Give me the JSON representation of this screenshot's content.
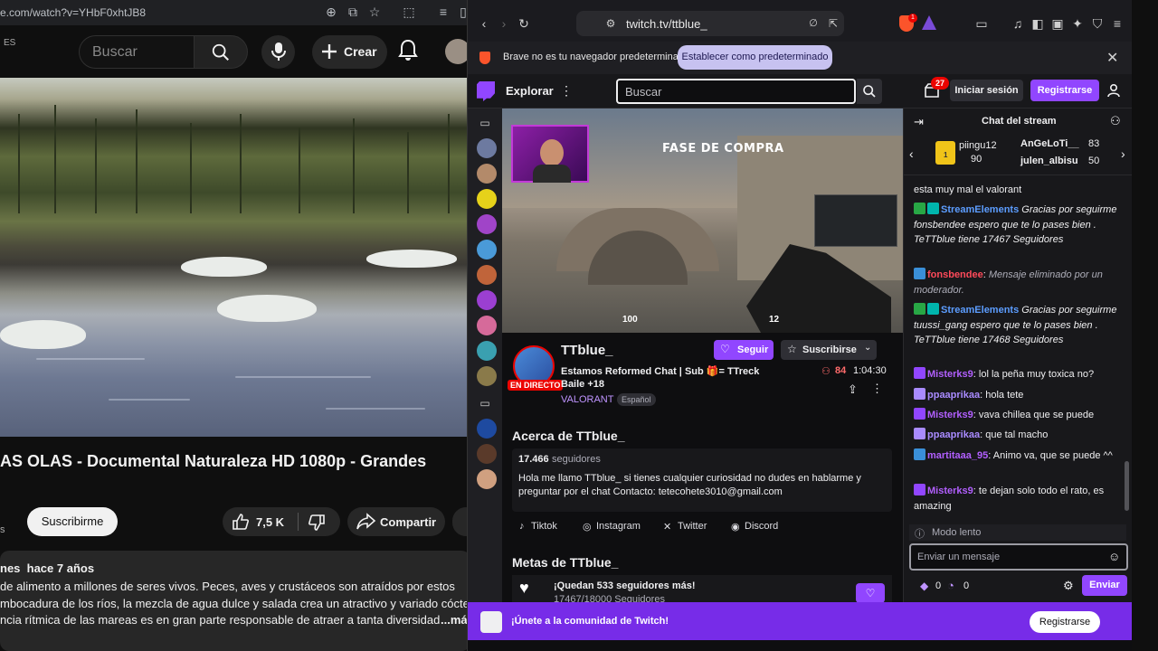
{
  "youtube": {
    "url": "e.com/watch?v=YHbF0xhtJB8",
    "country_code": "ES",
    "search_placeholder": "Buscar",
    "create_label": "Crear",
    "video_title": "AS OLAS - Documental Naturaleza HD 1080p - Grandes",
    "subscribe_label": "Suscribirme",
    "likes": "7,5 K",
    "share_label": "Compartir",
    "channel_suffix": "s",
    "desc_meta_views": "nes",
    "desc_meta_date": "hace 7 años",
    "desc_line1": "de alimento a millones de seres vivos. Peces, aves y crustáceos son atraídos por estos",
    "desc_line2": "mbocadura de los ríos, la mezcla de agua dulce y salada crea un atractivo y variado cóctel,",
    "desc_line3": "ncia rítmica de las mareas es en gran parte responsable de atraer a tanta diversidad",
    "desc_more": "...más"
  },
  "browser": {
    "url": "twitch.tv/ttblue_",
    "notice_text": "Brave no es tu navegador predeterminado",
    "notice_button": "Establecer como predeterminado",
    "shield_count": "1"
  },
  "twitch": {
    "nav": {
      "explore": "Explorar",
      "search_placeholder": "Buscar",
      "notifications_count": "27",
      "login": "Iniciar sesión",
      "signup": "Registrarse"
    },
    "player": {
      "overlay_title": "FASE DE COMPRA",
      "hud_health": "100",
      "hud_ammo": "12"
    },
    "stream": {
      "channel": "TTblue_",
      "follow": "Seguir",
      "subscribe": "Suscribirse",
      "title_line1": "Estamos Reformed Chat | Sub 🎁= TTreck",
      "title_line2": "Baile +18",
      "live_badge": "EN DIRECTO",
      "category": "VALORANT",
      "language": "Español",
      "viewers": "84",
      "uptime": "1:04:30"
    },
    "about": {
      "heading": "Acerca de TTblue_",
      "followers_count": "17.466",
      "followers_label": "seguidores",
      "bio": "Hola me llamo TTblue_ si tienes cualquier curiosidad no dudes en hablarme y preguntar por el chat Contacto: tetecohete3010@gmail.com",
      "socials": [
        "Tiktok",
        "Instagram",
        "Twitter",
        "Discord"
      ]
    },
    "goals": {
      "heading": "Metas de TTblue_",
      "goal_title": "¡Quedan 533 seguidores más!",
      "goal_progress": "17467/18000 Seguidores"
    },
    "chat": {
      "header": "Chat del stream",
      "leaderboard": [
        {
          "name": "piingu12",
          "score": "90",
          "rank": "1"
        },
        {
          "name": "AnGeLoTi__",
          "score": "83"
        },
        {
          "name": "julen_albisu",
          "score": "50"
        }
      ],
      "messages": [
        {
          "user": "",
          "text": "esta muy mal el valorant",
          "color": "#efeff1"
        },
        {
          "user": "StreamElements",
          "text": "Gracias por seguirme fonsbendee espero que te lo pases bien . TeTTblue tiene 17467 Seguidores",
          "color": "#5c9dff"
        },
        {
          "user": "fonsbendee",
          "text": "Mensaje eliminado por un moderador.",
          "color": "#ff4a5a"
        },
        {
          "user": "StreamElements",
          "text": "Gracias por seguirme tuussi_gang espero que te lo pases bien . TeTTblue tiene 17468 Seguidores",
          "color": "#5c9dff"
        },
        {
          "user": "Misterks9",
          "text": "lol la peña muy toxica no?",
          "color": "#b25fff"
        },
        {
          "user": "ppaaprikaa",
          "text": "hola tete",
          "color": "#a98bff"
        },
        {
          "user": "Misterks9",
          "text": "vava chillea que se puede",
          "color": "#b25fff"
        },
        {
          "user": "ppaaprikaa",
          "text": "que tal macho",
          "color": "#a98bff"
        },
        {
          "user": "martitaaa_95",
          "text": "Animo va, que se puede ^^",
          "color": "#b25fff"
        },
        {
          "user": "Misterks9",
          "text": "te dejan solo todo el rato, es amazing",
          "color": "#b25fff"
        }
      ],
      "slow_mode": "Modo lento",
      "input_placeholder": "Enviar un mensaje",
      "points_a": "0",
      "points_b": "0",
      "send": "Enviar"
    },
    "join_banner": {
      "text": "¡Únete a la comunidad de Twitch!",
      "button": "Registrarse"
    }
  },
  "colors": {
    "twitch_purple": "#9146ff",
    "live_red": "#eb0400",
    "brave_orange": "#fb542b"
  }
}
